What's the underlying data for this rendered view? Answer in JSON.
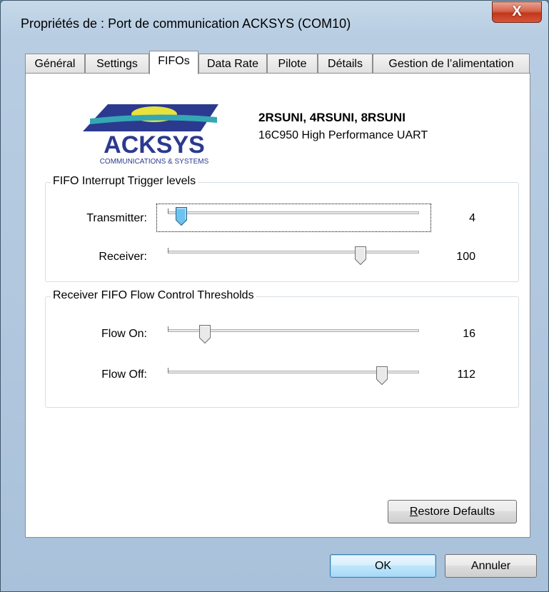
{
  "window": {
    "title": "Propriétés de : Port de communication ACKSYS (COM10)",
    "close_glyph": "X"
  },
  "tabs": [
    {
      "label": "Général"
    },
    {
      "label": "Settings"
    },
    {
      "label": "FIFOs",
      "active": true
    },
    {
      "label": "Data Rate"
    },
    {
      "label": "Pilote"
    },
    {
      "label": "Détails"
    },
    {
      "label": "Gestion de l’alimentation"
    }
  ],
  "logo": {
    "name": "ACKSYS",
    "tagline": "COMMUNICATIONS & SYSTEMS",
    "colors": {
      "navy": "#2b3a8f",
      "teal": "#35a7b4",
      "yellow": "#e9e23c"
    }
  },
  "product": {
    "title": "2RSUNI, 4RSUNI, 8RSUNI",
    "subtitle": "16C950 High Performance UART"
  },
  "fifo_group": {
    "title": "FIFO Interrupt Trigger levels",
    "transmitter": {
      "label": "Transmitter:",
      "value": "4",
      "level": 0.03
    },
    "receiver": {
      "label": "Receiver:",
      "value": "100",
      "level": 0.78
    }
  },
  "flow_group": {
    "title": "Receiver FIFO Flow Control Thresholds",
    "flow_on": {
      "label": "Flow On:",
      "value": "16",
      "level": 0.13
    },
    "flow_off": {
      "label": "Flow Off:",
      "value": "112",
      "level": 0.87
    }
  },
  "buttons": {
    "restore_accel": "R",
    "restore_rest": "estore Defaults",
    "ok": "OK",
    "cancel": "Annuler"
  },
  "accent": "#3c7fb1"
}
